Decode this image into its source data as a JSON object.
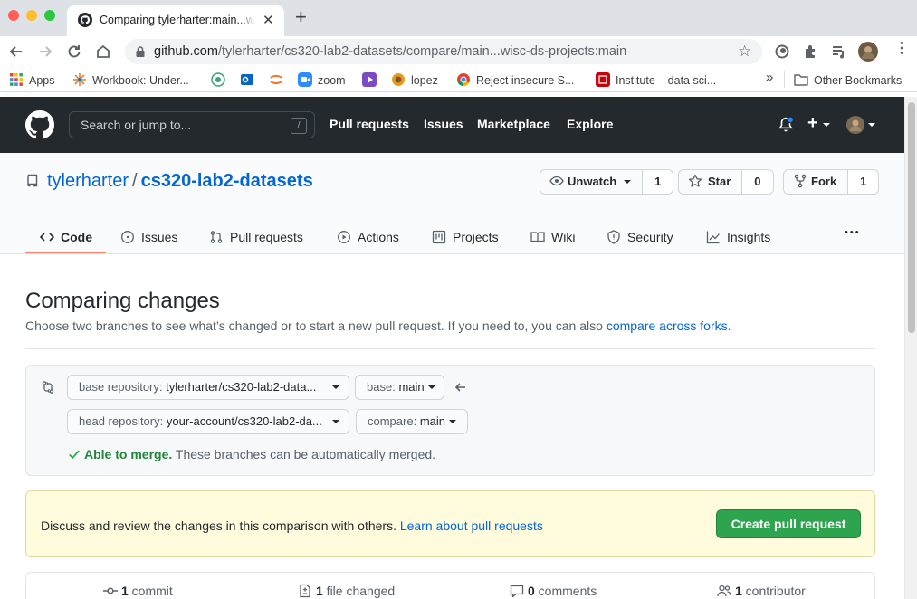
{
  "browser": {
    "tab_title": "Comparing tylerharter:main...wisc-ds-projects:main",
    "tab_close": "✕",
    "new_tab": "+",
    "url_host": "github.com",
    "url_path": "/tylerharter/cs320-lab2-datasets/compare/main...wisc-ds-projects:main",
    "bookmarks": [
      {
        "label": "Apps",
        "icon": "apps-grid-icon"
      },
      {
        "label": "Workbook: Under...",
        "icon": "workbook-icon"
      },
      {
        "label": "",
        "icon": "green-circle-icon"
      },
      {
        "label": "",
        "icon": "outlook-icon"
      },
      {
        "label": "",
        "icon": "orange-arc-icon"
      },
      {
        "label": "zoom",
        "icon": "zoom-icon"
      },
      {
        "label": "",
        "icon": "purple-play-icon"
      },
      {
        "label": "lopez",
        "icon": "lopez-icon"
      },
      {
        "label": "Reject insecure S...",
        "icon": "chrome-icon"
      },
      {
        "label": "Institute – data sci...",
        "icon": "institute-icon"
      }
    ],
    "overflow": "»",
    "other_bookmarks": "Other Bookmarks"
  },
  "gh_header": {
    "search_placeholder": "Search or jump to...",
    "search_shortcut": "/",
    "nav": [
      "Pull requests",
      "Issues",
      "Marketplace",
      "Explore"
    ],
    "plus": "+"
  },
  "repo": {
    "owner": "tylerharter",
    "separator": "/",
    "name": "cs320-lab2-datasets",
    "unwatch_label": "Unwatch",
    "watch_count": "1",
    "star_label": "Star",
    "star_count": "0",
    "fork_label": "Fork",
    "fork_count": "1",
    "tabs": [
      "Code",
      "Issues",
      "Pull requests",
      "Actions",
      "Projects",
      "Wiki",
      "Security",
      "Insights"
    ],
    "more": "•••"
  },
  "compare": {
    "title": "Comparing changes",
    "description": "Choose two branches to see what’s changed or to start a new pull request. If you need to, you can also ",
    "forks_link": "compare across forks",
    "period": ".",
    "base_repo_prefix": "base repository:",
    "base_repo_value": "tylerharter/cs320-lab2-data...",
    "base_prefix": "base:",
    "base_value": "main",
    "head_repo_prefix": "head repository:",
    "head_repo_value": "your-account/cs320-lab2-da...",
    "compare_prefix": "compare:",
    "compare_value": "main",
    "merge_ok": "Able to merge.",
    "merge_detail": " These branches can be automatically merged."
  },
  "flash": {
    "text": "Discuss and review the changes in this comparison with others. ",
    "link": "Learn about pull requests",
    "button": "Create pull request"
  },
  "stats": {
    "commits_n": "1",
    "commits_label": " commit",
    "files_n": "1",
    "files_label": " file changed",
    "comments_n": "0",
    "comments_label": " comments",
    "contrib_n": "1",
    "contrib_label": " contributor"
  },
  "colors": {
    "header_bg": "#24292e",
    "link": "#0366d6",
    "success": "#2ea44f",
    "tab_underline": "#f9826c",
    "flash_bg": "#fffbdd"
  }
}
